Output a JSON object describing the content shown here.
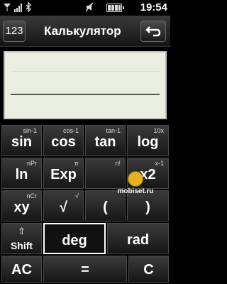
{
  "status_bar": {
    "clock": "19:54",
    "icons": [
      "signal-icon",
      "bluetooth-icon",
      "mute-icon",
      "battery-icon"
    ]
  },
  "header": {
    "mode_button": "123",
    "title": "Калькулятор",
    "back_icon": "back-arrow-icon"
  },
  "display": {
    "expression": "",
    "result": ""
  },
  "keys": {
    "sin": {
      "main": "sin",
      "sup": "sin-1"
    },
    "cos": {
      "main": "cos",
      "sup": "cos-1"
    },
    "tan": {
      "main": "tan",
      "sup": "tan-1"
    },
    "log": {
      "main": "log",
      "sup": "10x"
    },
    "ln": {
      "main": "ln",
      "sup": "nPr"
    },
    "exp": {
      "main": "Exp",
      "sup": "π"
    },
    "nfact": {
      "main": "",
      "sup": "n!"
    },
    "xsq": {
      "main": "x2",
      "sup": "x-1"
    },
    "xy": {
      "main": "xy",
      "sup": "nCr"
    },
    "sqrt": {
      "main": "√",
      "sup": "√"
    },
    "lparen": {
      "main": "("
    },
    "rparen": {
      "main": ")"
    },
    "shift": {
      "main": "Shift",
      "arrow": "⇧"
    },
    "deg": {
      "main": "deg"
    },
    "rad": {
      "main": "rad"
    },
    "ac": {
      "main": "AC"
    },
    "equals": {
      "main": "="
    },
    "c": {
      "main": "C"
    }
  },
  "watermark": {
    "text": "mobiset.ru"
  }
}
